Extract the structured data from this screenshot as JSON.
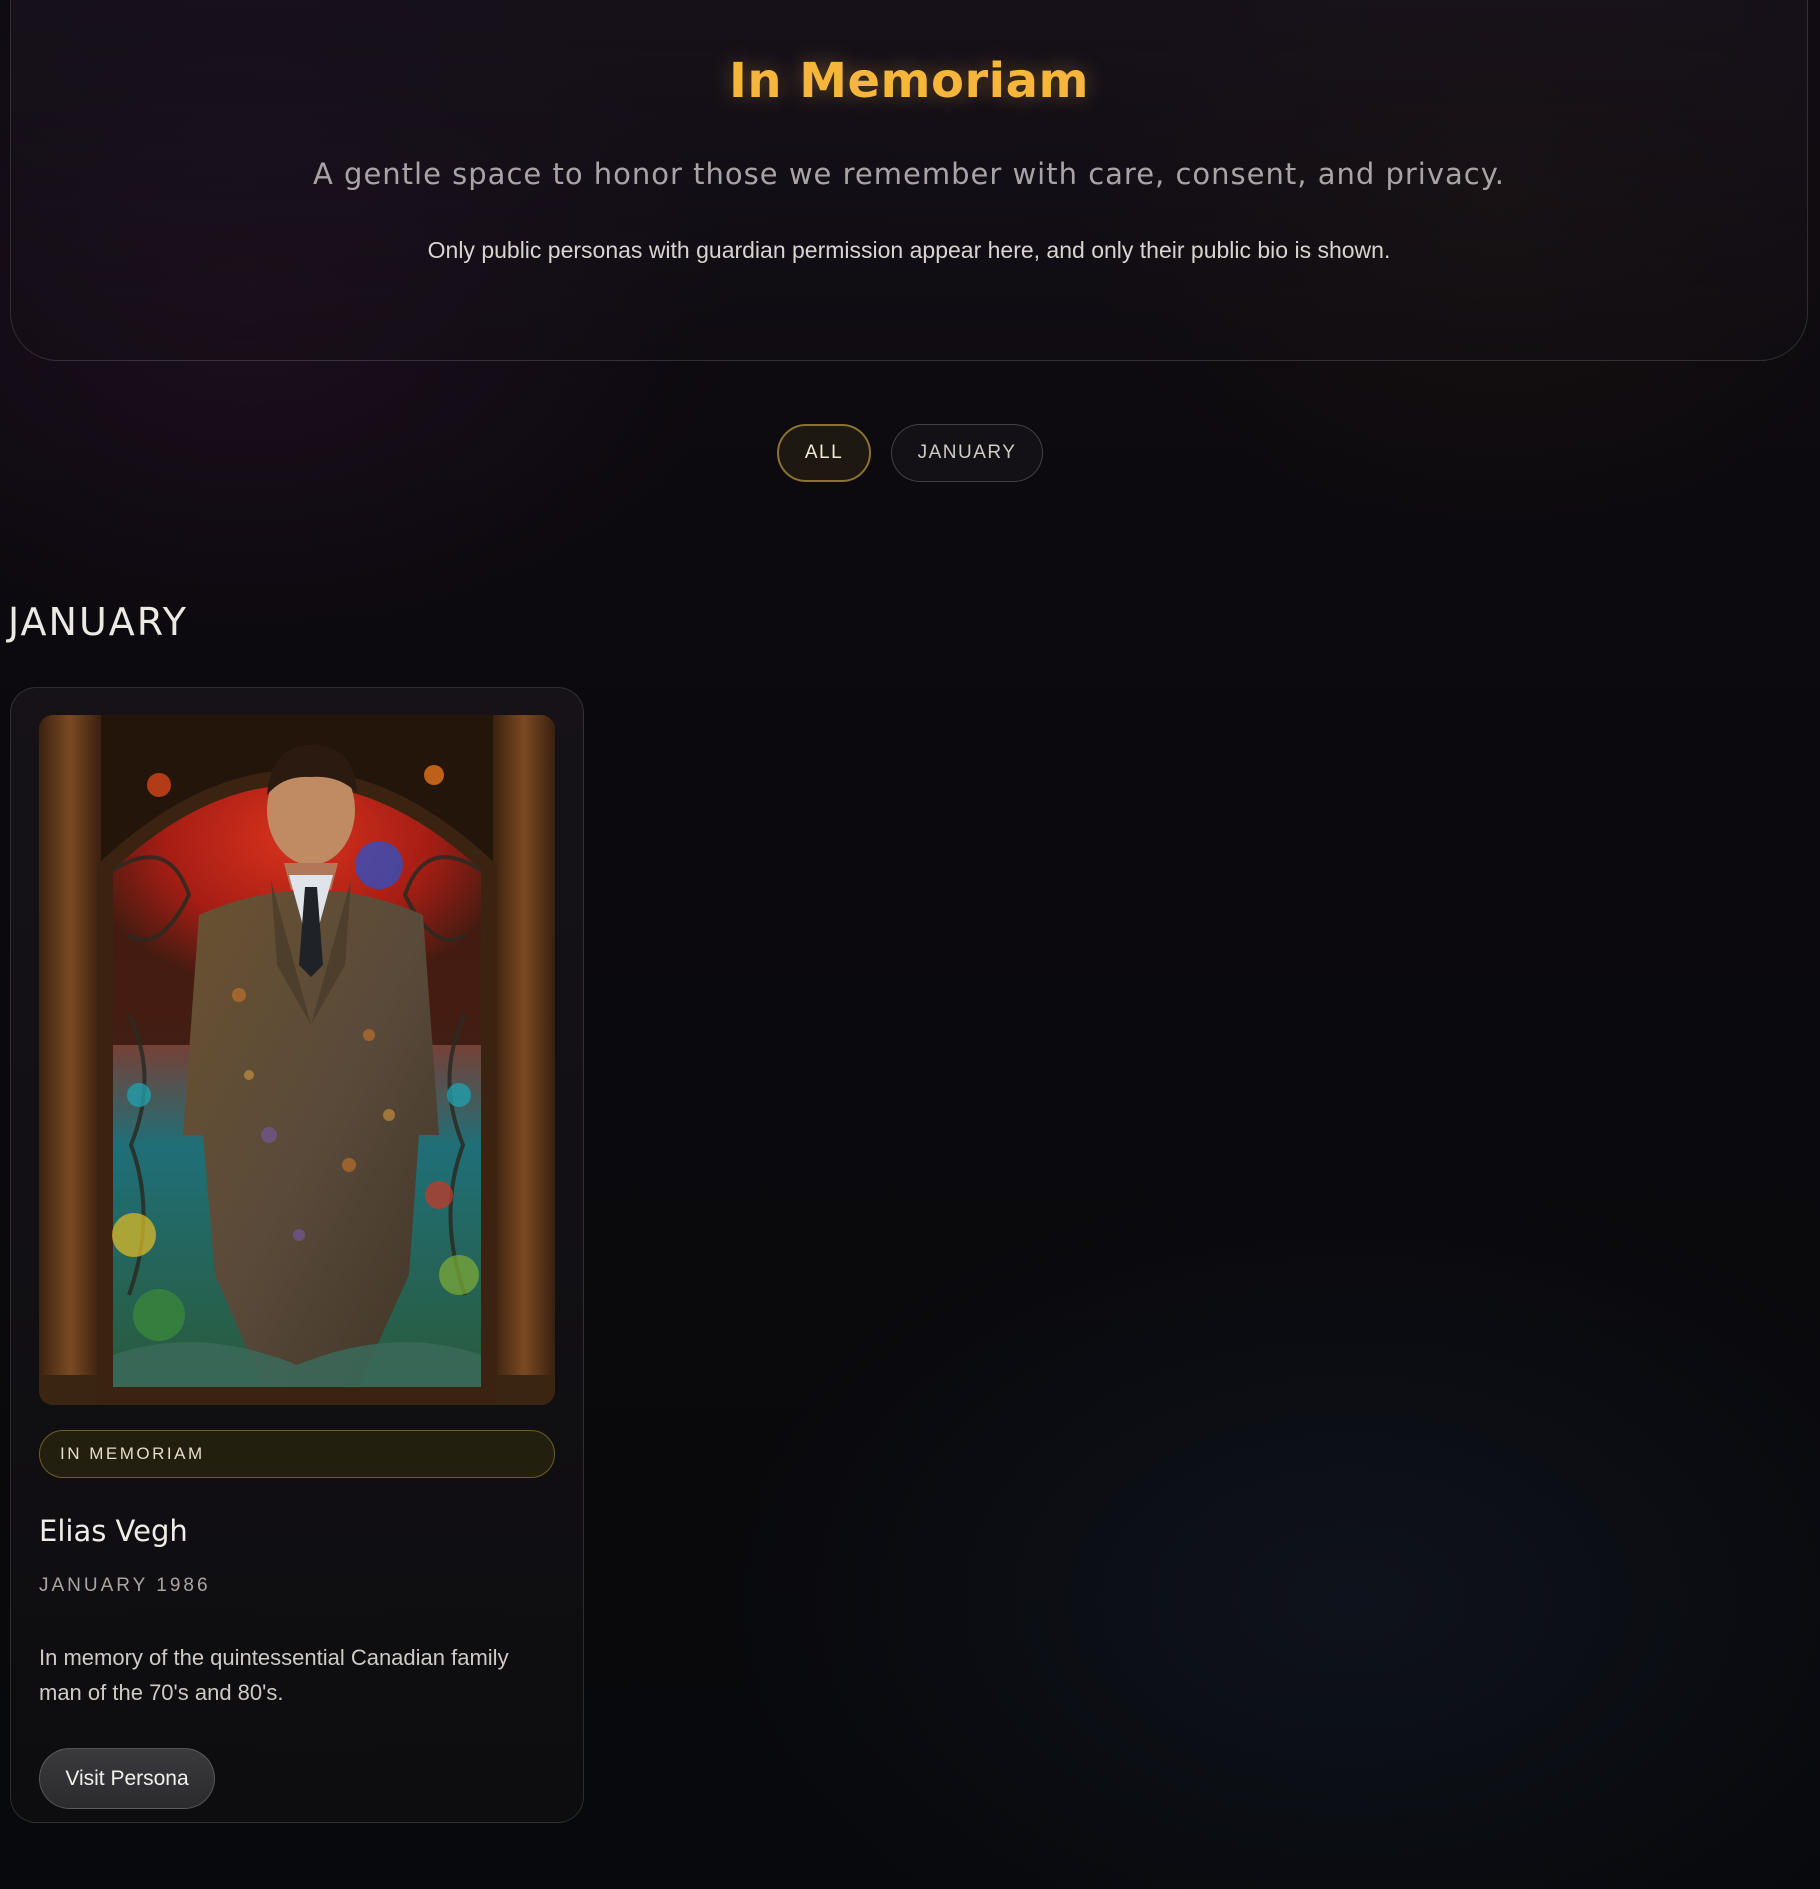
{
  "hero": {
    "title": "In Memoriam",
    "subtitle": "A gentle space to honor those we remember with care, consent, and privacy.",
    "note": "Only public personas with guardian permission appear here, and only their public bio is shown."
  },
  "filters": {
    "items": [
      {
        "label": "ALL",
        "active": true
      },
      {
        "label": "JANUARY",
        "active": false
      }
    ]
  },
  "sections": [
    {
      "heading": "JANUARY",
      "cards": [
        {
          "badge": "IN MEMORIAM",
          "name": "Elias Vegh",
          "date": "JANUARY 1986",
          "bio": "In memory of the quintessential Canadian family man of the 70's and 80's.",
          "button": "Visit Persona"
        }
      ]
    }
  ],
  "colors": {
    "accent_gold": "#f6b63c",
    "background": "#0a090c",
    "badge_border": "#6d5e22",
    "active_pill_border": "#8a7230"
  }
}
